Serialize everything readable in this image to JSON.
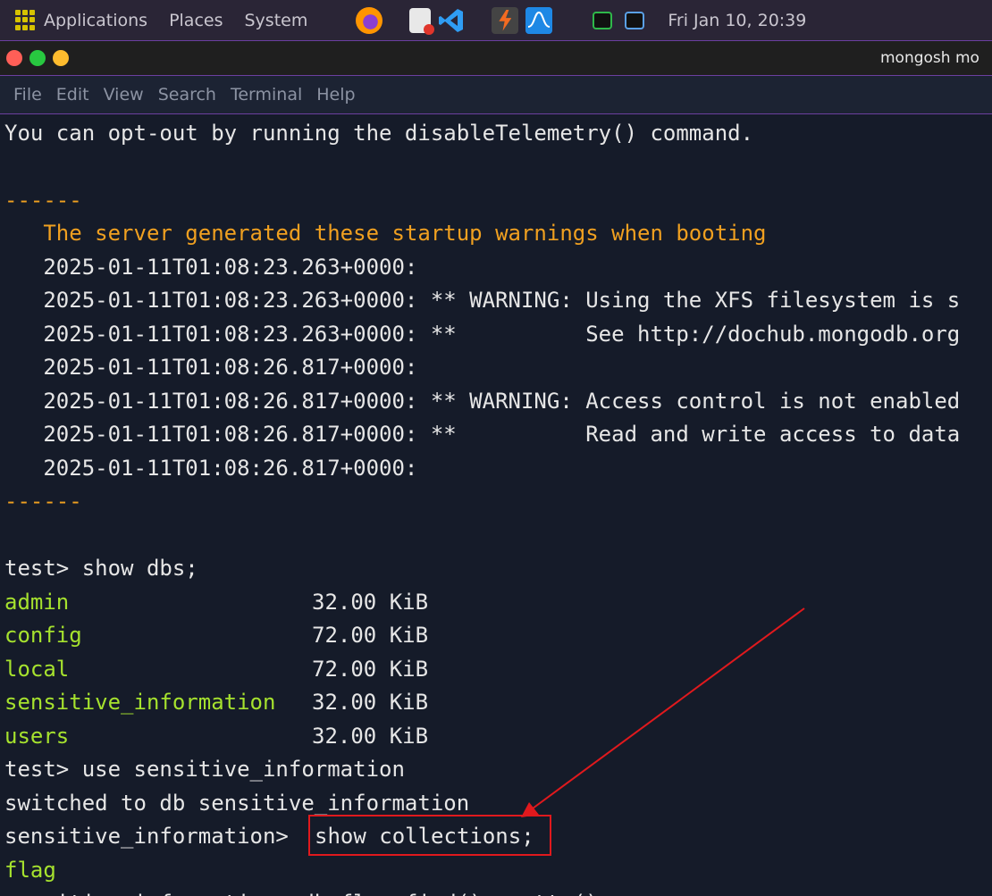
{
  "panel": {
    "menus": [
      "Applications",
      "Places",
      "System"
    ],
    "clock": "Fri Jan 10, 20:39"
  },
  "window": {
    "title": "mongosh mo"
  },
  "menubar": [
    "File",
    "Edit",
    "View",
    "Search",
    "Terminal",
    "Help"
  ],
  "terminal": {
    "lines": {
      "telemetry": "You can opt-out by running the disableTelemetry() command.",
      "dashes1": "------",
      "warn_header": "   The server generated these startup warnings when booting",
      "w1": "   2025-01-11T01:08:23.263+0000:",
      "w2": "   2025-01-11T01:08:23.263+0000: ** WARNING: Using the XFS filesystem is s",
      "w3": "   2025-01-11T01:08:23.263+0000: **          See http://dochub.mongodb.org",
      "w4": "   2025-01-11T01:08:26.817+0000:",
      "w5": "   2025-01-11T01:08:26.817+0000: ** WARNING: Access control is not enabled",
      "w6": "   2025-01-11T01:08:26.817+0000: **          Read and write access to data",
      "w7": "   2025-01-11T01:08:26.817+0000:",
      "dashes2": "------",
      "show_dbs": "test> show dbs;",
      "use_cmd": "test> use sensitive_information",
      "switched": "switched to db sensitive_information",
      "prompt": "sensitive_information> ",
      "show_collections": "show collections;",
      "flag": "flag",
      "partial": "sensitive_information> db.flag.find().pretty()"
    },
    "dbs": [
      {
        "name": "admin",
        "size": "32.00 KiB"
      },
      {
        "name": "config",
        "size": "72.00 KiB"
      },
      {
        "name": "local",
        "size": "72.00 KiB"
      },
      {
        "name": "sensitive_information",
        "size": "32.00 KiB"
      },
      {
        "name": "users",
        "size": "32.00 KiB"
      }
    ]
  },
  "colors": {
    "warning_text": "#f0a020",
    "db_name": "#a6e22e",
    "annotation": "#e0191d",
    "terminal_bg": "#151b29"
  }
}
